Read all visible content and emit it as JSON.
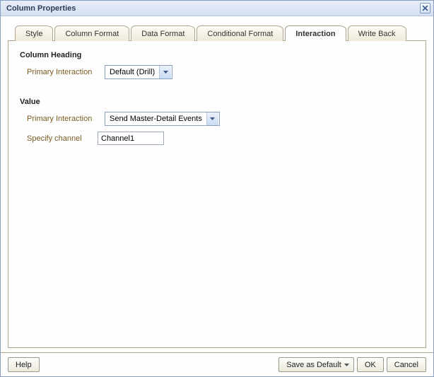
{
  "title": "Column Properties",
  "tabs": {
    "style": "Style",
    "column_format": "Column Format",
    "data_format": "Data Format",
    "conditional_format": "Conditional Format",
    "interaction": "Interaction",
    "write_back": "Write Back"
  },
  "sections": {
    "column_heading": {
      "title": "Column Heading",
      "primary_interaction_label": "Primary Interaction",
      "primary_interaction_value": "Default (Drill)"
    },
    "value": {
      "title": "Value",
      "primary_interaction_label": "Primary Interaction",
      "primary_interaction_value": "Send Master-Detail Events",
      "specify_channel_label": "Specify channel",
      "specify_channel_value": "Channel1"
    }
  },
  "footer": {
    "help": "Help",
    "save_as_default": "Save as Default",
    "ok": "OK",
    "cancel": "Cancel"
  }
}
